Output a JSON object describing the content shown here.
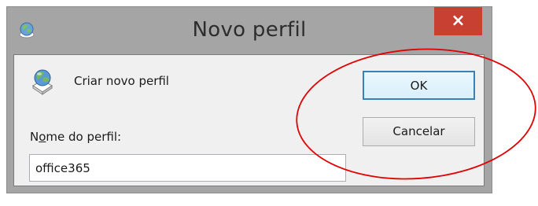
{
  "dialog": {
    "title": "Novo perfil",
    "close_glyph": "×",
    "create_label": "Criar novo perfil",
    "name_label_prefix": "N",
    "name_label_underlined": "o",
    "name_label_suffix": "me do perfil:",
    "name_value": "office365",
    "ok_label": "OK",
    "cancel_label": "Cancelar"
  },
  "icons": {
    "title_icon": "profile-globe-icon",
    "body_icon": "profile-globe-icon",
    "close_icon": "close-icon"
  },
  "colors": {
    "close_button": "#c84031",
    "ok_border": "#3c7fb1",
    "annotation_ellipse": "#e00000"
  }
}
